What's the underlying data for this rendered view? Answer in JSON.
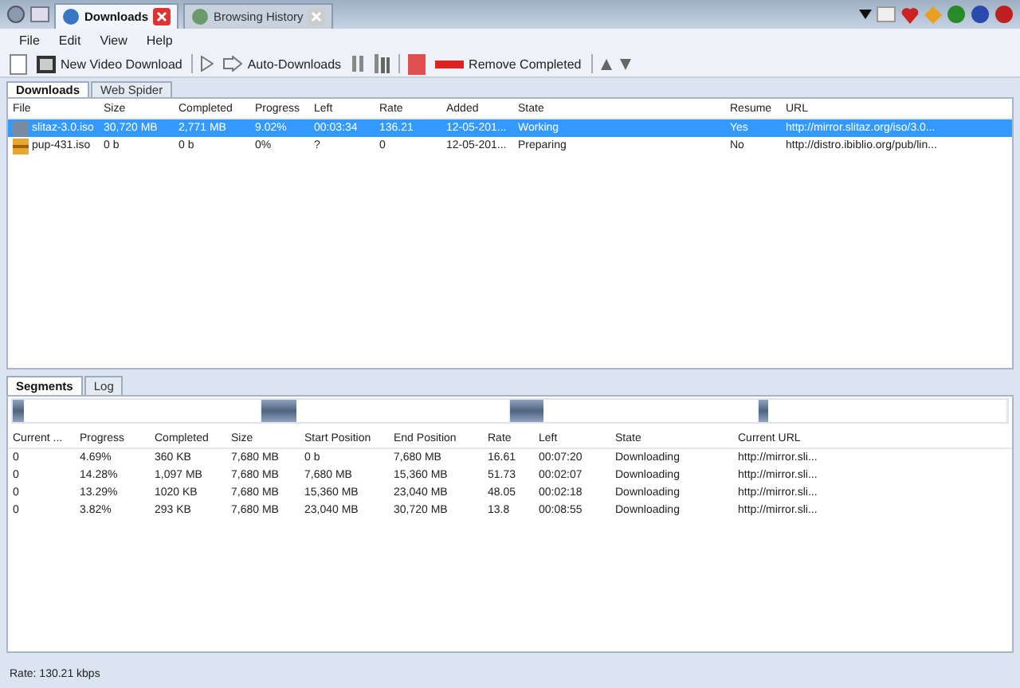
{
  "browser_tabs": [
    {
      "label": "Downloads",
      "selected": true
    },
    {
      "label": "Browsing History",
      "selected": false
    }
  ],
  "menu": [
    "File",
    "Edit",
    "View",
    "Help"
  ],
  "toolbar": {
    "new_video": "New Video Download",
    "auto": "Auto-Downloads",
    "remove": "Remove Completed"
  },
  "view_tabs": [
    {
      "label": "Downloads",
      "selected": true
    },
    {
      "label": "Web Spider",
      "selected": false
    }
  ],
  "downloads": {
    "columns": [
      "File",
      "Size",
      "Completed",
      "Progress",
      "Left",
      "Rate",
      "Added",
      "State",
      "Resume",
      "URL"
    ],
    "rows": [
      {
        "selected": true,
        "kind": "disk",
        "cells": [
          "slitaz-3.0.iso",
          "30,720 MB",
          "2,771 MB",
          "9.02%",
          "00:03:34",
          "136.21",
          "12-05-201...",
          "Working",
          "Yes",
          "http://mirror.slitaz.org/iso/3.0..."
        ]
      },
      {
        "selected": false,
        "kind": "package",
        "cells": [
          "pup-431.iso",
          "0 b",
          "0 b",
          "0%",
          "?",
          "0",
          "12-05-201...",
          "Preparing",
          "No",
          "http://distro.ibiblio.org/pub/lin..."
        ]
      }
    ]
  },
  "detail_tabs": [
    {
      "label": "Segments",
      "selected": true
    },
    {
      "label": "Log",
      "selected": false
    }
  ],
  "segments": {
    "columns": [
      "Current ...",
      "Progress",
      "Completed",
      "Size",
      "Start Position",
      "End Position",
      "Rate",
      "Left",
      "State",
      "Current URL"
    ],
    "rows": [
      {
        "level": 0.0469,
        "cells": [
          "0",
          "4.69%",
          "360 KB",
          "7,680 MB",
          "0 b",
          "7,680 MB",
          "16.61",
          "00:07:20",
          "Downloading",
          "http://mirror.sli..."
        ]
      },
      {
        "level": 0.1428,
        "cells": [
          "0",
          "14.28%",
          "1,097 MB",
          "7,680 MB",
          "7,680 MB",
          "15,360 MB",
          "51.73",
          "00:02:07",
          "Downloading",
          "http://mirror.sli..."
        ]
      },
      {
        "level": 0.1329,
        "cells": [
          "0",
          "13.29%",
          "1020 KB",
          "7,680 MB",
          "15,360 MB",
          "23,040 MB",
          "48.05",
          "00:02:18",
          "Downloading",
          "http://mirror.sli..."
        ]
      },
      {
        "level": 0.0382,
        "cells": [
          "0",
          "3.82%",
          "293 KB",
          "7,680 MB",
          "23,040 MB",
          "30,720 MB",
          "13.8",
          "00:08:55",
          "Downloading",
          "http://mirror.sli..."
        ]
      }
    ]
  },
  "status": "Rate: 130.21 kbps"
}
